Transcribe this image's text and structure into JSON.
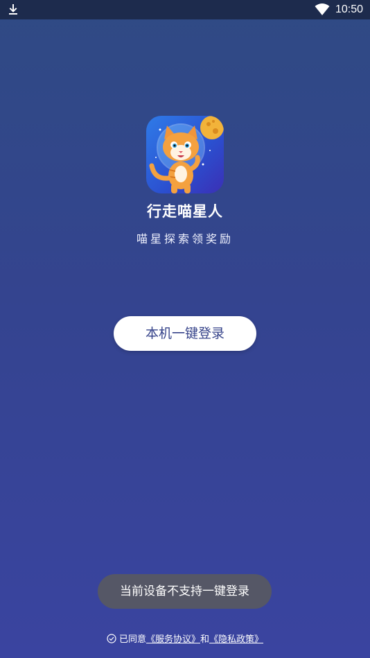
{
  "status_bar": {
    "time": "10:50",
    "icons": [
      "download-icon",
      "wifi-icon"
    ]
  },
  "app": {
    "name": "行走喵星人",
    "slogan": "喵星探索领奖励",
    "icon": "cat-astronaut-app-icon"
  },
  "login": {
    "button_label": "本机一键登录"
  },
  "toast": {
    "message": "当前设备不支持一键登录"
  },
  "agreement": {
    "prefix": "已同意",
    "service_link": "《服务协议》",
    "joiner": "和",
    "privacy_link": "《隐私政策》"
  },
  "colors": {
    "background_top": "#2f4a84",
    "background_bottom": "#3a44a0",
    "button_text": "#36438a",
    "toast_bg": "#555766"
  }
}
